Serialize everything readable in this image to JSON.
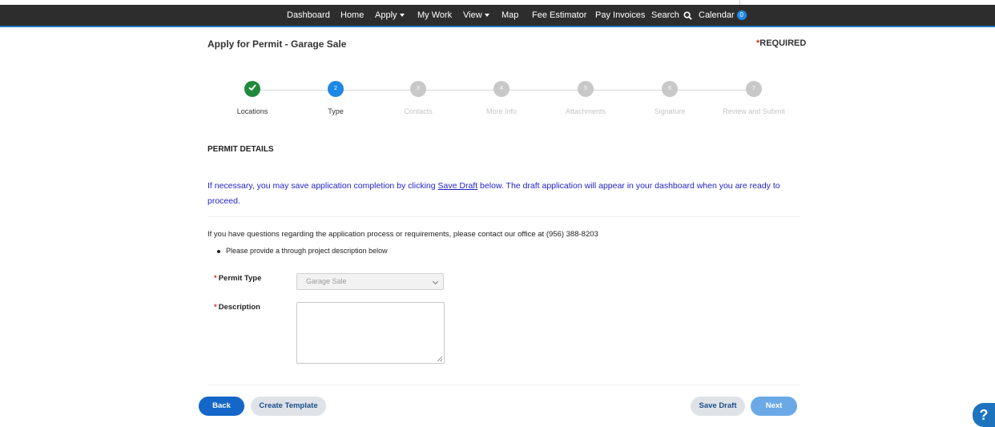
{
  "nav": {
    "items": [
      {
        "label": "Dashboard"
      },
      {
        "label": "Home"
      },
      {
        "label": "Apply"
      },
      {
        "label": "My Work"
      },
      {
        "label": "View"
      },
      {
        "label": "Map"
      },
      {
        "label": "Fee Estimator"
      },
      {
        "label": "Pay Invoices"
      },
      {
        "label": "Search"
      },
      {
        "label": "Calendar"
      }
    ],
    "calendar_count": "0"
  },
  "page": {
    "title": "Apply for Permit - Garage Sale",
    "required_star": "*",
    "required_label": "REQUIRED"
  },
  "steps": [
    {
      "number": "1",
      "label": "Locations",
      "state": "done"
    },
    {
      "number": "2",
      "label": "Type",
      "state": "active"
    },
    {
      "number": "3",
      "label": "Contacts",
      "state": "pending"
    },
    {
      "number": "4",
      "label": "More Info",
      "state": "pending"
    },
    {
      "number": "5",
      "label": "Attachments",
      "state": "pending"
    },
    {
      "number": "6",
      "label": "Signature",
      "state": "pending"
    },
    {
      "number": "7",
      "label": "Review and Submit",
      "state": "pending"
    }
  ],
  "details": {
    "section_title": "PERMIT DETAILS",
    "info_before": "If necessary, you may save application completion by clicking ",
    "info_link": "Save Draft",
    "info_after": " below.  The draft application will appear in your dashboard when you are ready to proceed.",
    "question": "If you have questions regarding the application process or requirements, please contact our office at (956) 388-8203",
    "bullet": "Please provide a through project description below"
  },
  "form": {
    "permit_type_label": "Permit Type",
    "permit_type_value": "Garage Sale",
    "description_label": "Description",
    "description_value": ""
  },
  "buttons": {
    "back": "Back",
    "create_template": "Create Template",
    "save_draft": "Save Draft",
    "next": "Next"
  },
  "help": {
    "label": "?"
  },
  "colors": {
    "topbar": "#2d2d2d",
    "accent": "#1e88e5",
    "done": "#1f8a3b",
    "info_text": "#2222cc"
  }
}
